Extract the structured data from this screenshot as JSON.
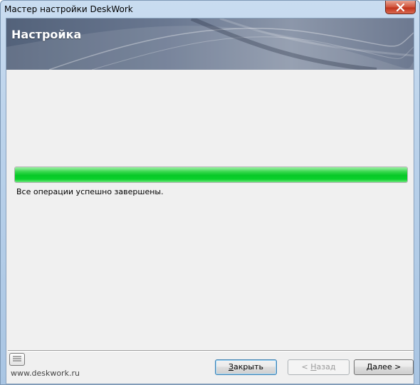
{
  "window": {
    "title": "Мастер настройки DeskWork"
  },
  "banner": {
    "title": "Настройка"
  },
  "progress": {
    "value_percent": 100,
    "status_text": "Все операции успешно завершены."
  },
  "footer": {
    "site_link": "www.deskwork.ru",
    "buttons": {
      "close": {
        "label_accel": "З",
        "label_rest": "акрыть",
        "enabled": true
      },
      "back": {
        "label_prefix": "< ",
        "label_accel": "Н",
        "label_rest": "азад",
        "enabled": false
      },
      "next": {
        "label_accel": "Д",
        "label_rest": "алее >",
        "enabled": true
      }
    }
  },
  "icons": {
    "close": "close-icon",
    "notes": "notes-icon"
  },
  "colors": {
    "progress_fill": "#06c826",
    "banner_base": "#6a7891",
    "close_button": "#c0331b"
  }
}
